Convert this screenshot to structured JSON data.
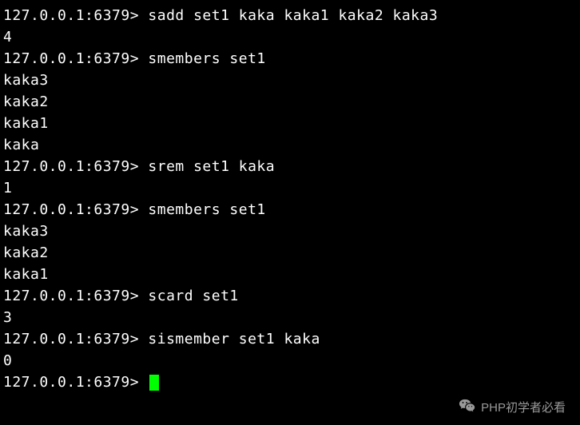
{
  "terminal": {
    "prompt": "127.0.0.1:6379>",
    "lines": [
      {
        "type": "cmd",
        "text": "sadd set1 kaka kaka1 kaka2 kaka3"
      },
      {
        "type": "out",
        "text": "4"
      },
      {
        "type": "cmd",
        "text": "smembers set1"
      },
      {
        "type": "out",
        "text": "kaka3"
      },
      {
        "type": "out",
        "text": "kaka2"
      },
      {
        "type": "out",
        "text": "kaka1"
      },
      {
        "type": "out",
        "text": "kaka"
      },
      {
        "type": "cmd",
        "text": "srem set1 kaka"
      },
      {
        "type": "out",
        "text": "1"
      },
      {
        "type": "cmd",
        "text": "smembers set1"
      },
      {
        "type": "out",
        "text": "kaka3"
      },
      {
        "type": "out",
        "text": "kaka2"
      },
      {
        "type": "out",
        "text": "kaka1"
      },
      {
        "type": "cmd",
        "text": "scard set1"
      },
      {
        "type": "out",
        "text": "3"
      },
      {
        "type": "cmd",
        "text": "sismember set1 kaka"
      },
      {
        "type": "out",
        "text": "0"
      },
      {
        "type": "cursor",
        "text": ""
      }
    ]
  },
  "watermark": {
    "text": "PHP初学者必看"
  }
}
